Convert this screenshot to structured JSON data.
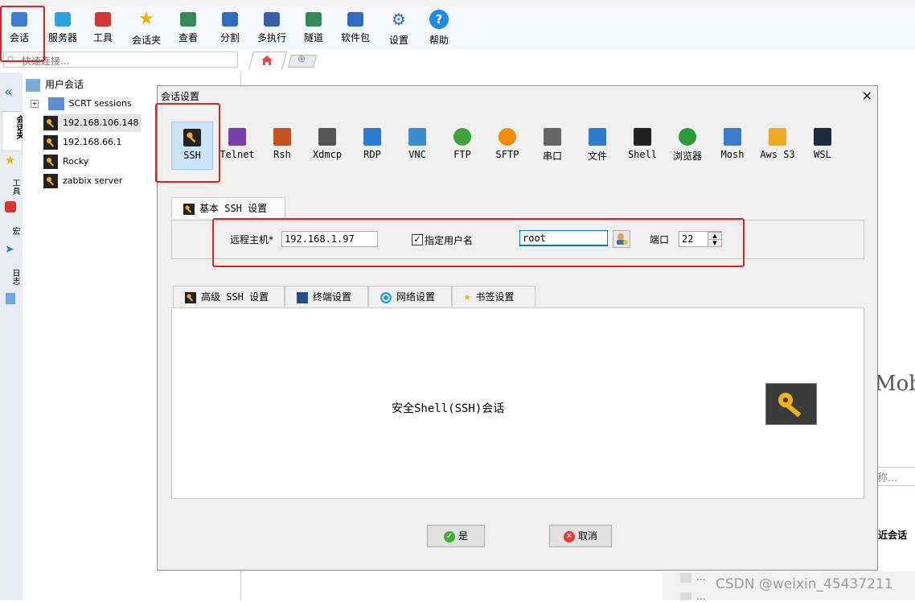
{
  "toolbar": {
    "items": [
      {
        "label": "会话",
        "icon": "session-icon"
      },
      {
        "label": "服务器",
        "icon": "servers-icon"
      },
      {
        "label": "工具",
        "icon": "tools-icon"
      },
      {
        "label": "会话夹",
        "icon": "star-icon"
      },
      {
        "label": "查看",
        "icon": "view-icon"
      },
      {
        "label": "分割",
        "icon": "split-icon"
      },
      {
        "label": "多执行",
        "icon": "multiexec-icon"
      },
      {
        "label": "隧道",
        "icon": "tunnel-icon"
      },
      {
        "label": "软件包",
        "icon": "packages-icon"
      },
      {
        "label": "设置",
        "icon": "gear-icon"
      },
      {
        "label": "帮助",
        "icon": "help-icon"
      }
    ]
  },
  "quick_connect": {
    "placeholder": "快速连接..."
  },
  "sidebar_tabs": [
    "会话夹",
    "工具",
    "宏",
    "日志"
  ],
  "tree": {
    "root": "用户会话",
    "folder": "SCRT sessions",
    "sessions": [
      "192.168.106.148",
      "192.168.66.1",
      "Rocky",
      "zabbix server"
    ]
  },
  "dialog": {
    "title": "会话设置",
    "close": "×",
    "types": [
      "SSH",
      "Telnet",
      "Rsh",
      "Xdmcp",
      "RDP",
      "VNC",
      "FTP",
      "SFTP",
      "串口",
      "文件",
      "Shell",
      "浏览器",
      "Mosh",
      "Aws S3",
      "WSL"
    ],
    "basic_tab": "基本 SSH 设置",
    "remote_host_label": "远程主机*",
    "remote_host": "192.168.1.97",
    "specify_user_label": "指定用户名",
    "specify_user_checked": true,
    "username": "root",
    "port_label": "端口",
    "port": "22",
    "bottom_tabs": [
      "高级 SSH 设置",
      "终端设置",
      "网络设置",
      "书签设置"
    ],
    "description": "安全Shell(SSH)会话",
    "ok": "是",
    "cancel": "取消"
  },
  "background": {
    "moba_text": "Moba",
    "name_hint": "称...",
    "recent_label": "最近会话",
    "dots1": "...",
    "dots2": "..."
  },
  "watermark": "CSDN @weixin_45437211",
  "colors": {
    "accent": "#0078d7",
    "highlight": "#e81e1e",
    "key_bg": "#232323",
    "key_gold": "#f2b311"
  }
}
